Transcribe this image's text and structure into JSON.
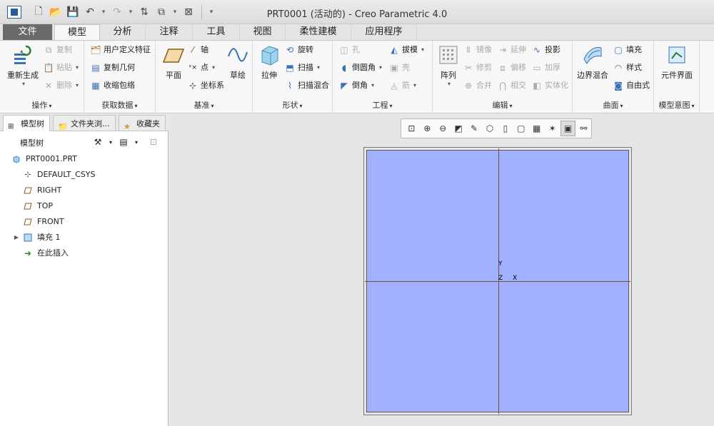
{
  "window": {
    "title": "PRT0001 (活动的) - Creo Parametric 4.0"
  },
  "tabs": [
    "文件",
    "模型",
    "分析",
    "注释",
    "工具",
    "视图",
    "柔性建模",
    "应用程序"
  ],
  "ribbon": {
    "operations": {
      "label": "操作",
      "regenerate": "重新生成",
      "copy": "复制",
      "paste": "粘贴",
      "delete": "删除"
    },
    "get_data": {
      "label": "获取数据",
      "udf": "用户定义特征",
      "copy_geom": "复制几何",
      "shrinkwrap": "收缩包络"
    },
    "datum": {
      "label": "基准",
      "plane": "平面",
      "axis": "轴",
      "point": "点",
      "csys": "坐标系",
      "sketch": "草绘"
    },
    "shapes": {
      "label": "形状",
      "extrude": "拉伸",
      "revolve": "旋转",
      "sweep": "扫描",
      "swept_blend": "扫描混合"
    },
    "engineering": {
      "label": "工程",
      "hole": "孔",
      "draft": "拔模",
      "round": "倒圆角",
      "shell": "壳",
      "chamfer": "倒角",
      "rib": "筋"
    },
    "editing": {
      "label": "编辑",
      "pattern": "阵列",
      "mirror": "镜像",
      "extend": "延伸",
      "project": "投影",
      "trim": "修剪",
      "offset": "偏移",
      "thicken": "加厚",
      "merge": "合并",
      "intersect": "相交",
      "solidify": "实体化"
    },
    "surfaces": {
      "label": "曲面",
      "boundary_blend": "边界混合",
      "fill": "填充",
      "style": "样式",
      "freestyle": "自由式"
    },
    "model_intent": {
      "label": "模型意图",
      "component_interface": "元件界面"
    }
  },
  "panel": {
    "tabs": [
      "模型树",
      "文件夹浏...",
      "收藏夹"
    ],
    "tree_title": "模型树",
    "items": [
      {
        "label": "PRT0001.PRT",
        "icon": "part-icon"
      },
      {
        "label": "DEFAULT_CSYS",
        "icon": "csys-icon"
      },
      {
        "label": "RIGHT",
        "icon": "datum-plane-icon"
      },
      {
        "label": "TOP",
        "icon": "datum-plane-icon"
      },
      {
        "label": "FRONT",
        "icon": "datum-plane-icon"
      },
      {
        "label": "填充 1",
        "icon": "fill-icon"
      },
      {
        "label": "在此插入",
        "icon": "insert-arrow-icon"
      }
    ]
  },
  "graphics": {
    "csys_labels": {
      "y": "Y",
      "z": "Z",
      "x": "X"
    },
    "plane_color": "#a1b1ff"
  }
}
